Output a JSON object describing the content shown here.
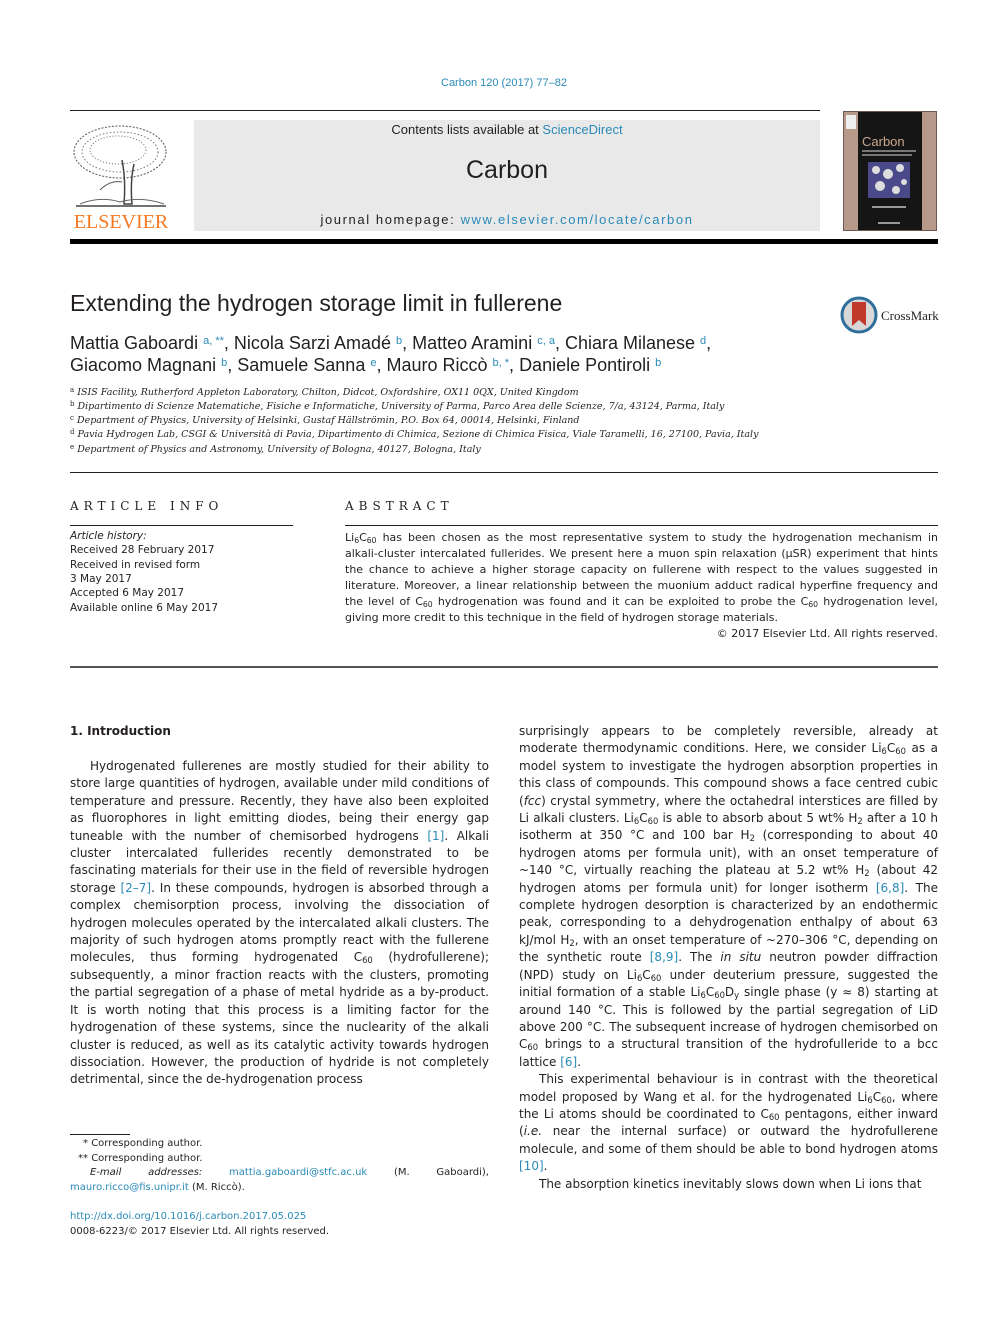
{
  "header": {
    "journal_ref": "Carbon 120 (2017) 77–82",
    "contents_prefix": "Contents lists available at ",
    "contents_link": "ScienceDirect",
    "journal_name": "Carbon",
    "homepage_prefix": "journal homepage: ",
    "homepage_link": "www.elsevier.com/locate/carbon",
    "publisher_logo_text": "ELSEVIER",
    "cover_title": "Carbon",
    "crossmark_label": "CrossMark"
  },
  "colors": {
    "link": "#2a8ab8",
    "elsevier_orange": "#f47920",
    "header_bg": "#e9e9e9",
    "cover_bg": "#b7998a"
  },
  "article": {
    "title": "Extending the hydrogen storage limit in fullerene",
    "authors_line1": [
      {
        "name": "Mattia Gaboardi",
        "sup": "a, **",
        "sep": ", "
      },
      {
        "name": "Nicola Sarzi Amadé",
        "sup": "b",
        "sep": ", "
      },
      {
        "name": "Matteo Aramini",
        "sup": "c, a",
        "sep": ", "
      },
      {
        "name": "Chiara Milanese",
        "sup": "d",
        "sep": ","
      }
    ],
    "authors_line2": [
      {
        "name": "Giacomo Magnani",
        "sup": "b",
        "sep": ", "
      },
      {
        "name": "Samuele Sanna",
        "sup": "e",
        "sep": ", "
      },
      {
        "name": "Mauro Riccò",
        "sup": "b, *",
        "sep": ", "
      },
      {
        "name": "Daniele Pontiroli",
        "sup": "b",
        "sep": ""
      }
    ],
    "affiliations": [
      {
        "key": "a",
        "text": "ISIS Facility, Rutherford Appleton Laboratory, Chilton, Didcot, Oxfordshire, OX11 0QX, United Kingdom"
      },
      {
        "key": "b",
        "text": "Dipartimento di Scienze Matematiche, Fisiche e Informatiche, University of Parma, Parco Area delle Scienze, 7/a, 43124, Parma, Italy"
      },
      {
        "key": "c",
        "text": "Department of Physics, University of Helsinki, Gustaf Hällströmin, P.O. Box 64, 00014, Helsinki, Finland"
      },
      {
        "key": "d",
        "text": "Pavia Hydrogen Lab, CSGI & Università di Pavia, Dipartimento di Chimica, Sezione di Chimica Fisica, Viale Taramelli, 16, 27100, Pavia, Italy"
      },
      {
        "key": "e",
        "text": "Department of Physics and Astronomy, University of Bologna, 40127, Bologna, Italy"
      }
    ]
  },
  "article_info": {
    "heading": "ARTICLE INFO",
    "history_title": "Article history:",
    "history": [
      "Received 28 February 2017",
      "Received in revised form",
      "3 May 2017",
      "Accepted 6 May 2017",
      "Available online 6 May 2017"
    ]
  },
  "abstract": {
    "heading": "ABSTRACT",
    "p1": " has been chosen as the most representative system to study the hydrogenation mechanism in alkali-cluster intercalated fullerides. We present here a muon spin relaxation (μSR) experiment that hints the chance to achieve a higher storage capacity on fullerene with respect to the values suggested in literature. Moreover, a linear relationship between the muonium adduct radical hyperfine frequency and the level of ",
    "p2": " hydrogenation was found and it can be exploited to probe the ",
    "p3": " hydrogenation level, giving more credit to this technique in the field of hydrogen storage materials.",
    "copyright": "© 2017 Elsevier Ltd. All rights reserved."
  },
  "body": {
    "intro_heading": "1.  Introduction",
    "left": {
      "t1": "Hydrogenated fullerenes are mostly studied for their ability to store large quantities of hydrogen, available under mild conditions of temperature and pressure. Recently, they have also been exploited as fluorophores in light emitting diodes, being their energy gap tuneable with the number of chemisorbed hydrogens ",
      "ref1": "[1]",
      "t2": ". Alkali cluster intercalated fullerides recently demonstrated to be fascinating materials for their use in the field of reversible hydrogen storage ",
      "ref2": "[2–7]",
      "t3": ". In these compounds, hydrogen is absorbed through a complex chemisorption process, involving the dissociation of hydrogen molecules operated by the intercalated alkali clusters. The majority of such hydrogen atoms promptly react with the fullerene molecules, thus forming hydrogenated ",
      "t4": " (hydrofullerene); subsequently, a minor fraction reacts with the clusters, promoting the partial segregation of a phase of metal hydride as a by-product. It is worth noting that this process is a limiting factor for the hydrogenation of these systems, since the nuclearity of the alkali cluster is reduced, as well as its catalytic activity towards hydrogen dissociation. However, the production of hydride is not completely detrimental, since the de-hydrogenation process"
    },
    "right": {
      "a1": "surprisingly appears to be completely reversible, already at moderate thermodynamic conditions. Here, we consider ",
      "a2": " as a model system to investigate the hydrogen absorption properties in this class of compounds. This compound shows a face centred cubic (",
      "fcc": "fcc",
      "a3": ") crystal symmetry, where the octahedral interstices are filled by Li alkali clusters. ",
      "a4": " is able to absorb about 5 wt% H",
      "a5": " after a 10 h isotherm at 350 °C and 100 bar H",
      "a6": " (corresponding to about 40 hydrogen atoms per formula unit), with an onset temperature of ~140 °C, virtually reaching the plateau at 5.2 wt% H",
      "a7": " (about 42 hydrogen atoms per formula unit) for longer isotherm ",
      "ref68": "[6,8]",
      "a8": ". The complete hydrogen desorption is characterized by an endothermic peak, corresponding to a dehydrogenation enthalpy of about 63 kJ/mol H",
      "a9": ", with an onset temperature of ~270–306 °C, depending on the synthetic route ",
      "ref89": "[8,9]",
      "a10": ". The ",
      "insitu": "in situ",
      "a11": " neutron powder diffraction (NPD) study on ",
      "a12": " under deuterium pressure, suggested the initial formation of a stable ",
      "a13": " single phase (y ≈ 8) starting at around 140 °C. This is followed by the partial segregation of LiD above 200 °C. The subsequent increase of hydrogen chemisorbed on ",
      "a14": " brings to a structural transition of the hydrofulleride to a bcc lattice ",
      "ref6": "[6]",
      "a15": ".",
      "b1": "This experimental behaviour is in contrast with the theoretical model proposed by Wang et al. for the hydrogenated ",
      "b2": ", where the Li atoms should be coordinated to ",
      "b3": " pentagons, either inward (",
      "ie": "i.e.",
      "b4": " near the internal surface) or outward the hydrofullerene molecule, and some of them should be able to bond hydrogen atoms ",
      "ref10": "[10]",
      "b5": ".",
      "c1": "The absorption kinetics inevitably slows down when Li ions that"
    },
    "chem": {
      "Li": "Li",
      "six": "6",
      "C": "C",
      "sixty": "60",
      "H": "H",
      "two": "2",
      "D": "D",
      "y": "y"
    }
  },
  "footnotes": {
    "corr1_mark": "*",
    "corr1": "Corresponding author.",
    "corr2_mark": "**",
    "corr2": "Corresponding author.",
    "email_label": "E-mail addresses:",
    "email1": "mattia.gaboardi@stfc.ac.uk",
    "email1_name": " (M. Gaboardi), ",
    "email2": "mauro.ricco@fis.unipr.it",
    "email2_name": " (M. Riccò).",
    "doi": "http://dx.doi.org/10.1016/j.carbon.2017.05.025",
    "issn": "0008-6223/© 2017 Elsevier Ltd. All rights reserved."
  }
}
